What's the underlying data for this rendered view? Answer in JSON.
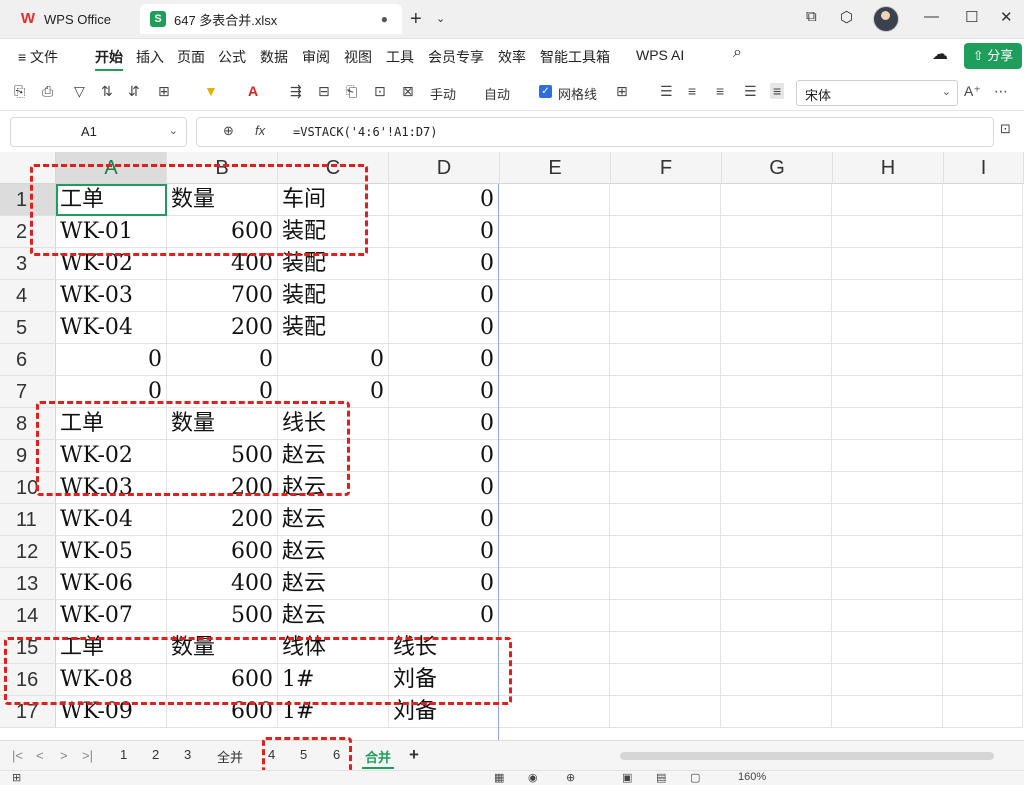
{
  "titlebar": {
    "app_tab_label": "WPS Office",
    "file_tab_label": "647 多表合并.xlsx",
    "close_glyph": "●",
    "new_tab_glyph": "+",
    "new_tab_more_glyph": "⌄",
    "controls": [
      "⧉",
      "⬡",
      "—",
      "☐",
      "✕"
    ]
  },
  "menu": {
    "items": [
      "≡ 文件",
      "开始",
      "插入",
      "页面",
      "公式",
      "数据",
      "审阅",
      "视图",
      "工具",
      "会员专享",
      "效率",
      "智能工具箱",
      "WPS AI"
    ],
    "active": "开始",
    "search_glyph": "⌕",
    "cloud_glyph": "☁",
    "share_label": "⇧ 分享"
  },
  "toolbar": {
    "icons": [
      "⎘",
      "⎙",
      "▽",
      "⇅",
      "⇵",
      "⊞",
      "▼",
      "A",
      "▼",
      "⇶",
      "⊟",
      "⎗",
      "⊡",
      "⊠"
    ],
    "manual_label": "手动",
    "auto_label": "自动",
    "gridlines_label": "网格线",
    "font_name": "宋体",
    "more_glyph": "⋯",
    "fontsize_glyph": "A⁺"
  },
  "formula_bar": {
    "name_box": "A1",
    "fx_label": "fx",
    "zoom_glyph": "⊕",
    "formula": "=VSTACK('4:6'!A1:D7)"
  },
  "columns": [
    "A",
    "B",
    "C",
    "D",
    "E",
    "F",
    "G",
    "H",
    "I"
  ],
  "rows": [
    {
      "n": "1",
      "a": "工单",
      "b": "数量",
      "c": "车间",
      "d": "0"
    },
    {
      "n": "2",
      "a": "WK-01",
      "b": "600",
      "c": "装配",
      "d": "0"
    },
    {
      "n": "3",
      "a": "WK-02",
      "b": "400",
      "c": "装配",
      "d": "0"
    },
    {
      "n": "4",
      "a": "WK-03",
      "b": "700",
      "c": "装配",
      "d": "0"
    },
    {
      "n": "5",
      "a": "WK-04",
      "b": "200",
      "c": "装配",
      "d": "0"
    },
    {
      "n": "6",
      "a": "0",
      "b": "0",
      "c": "0",
      "d": "0"
    },
    {
      "n": "7",
      "a": "0",
      "b": "0",
      "c": "0",
      "d": "0"
    },
    {
      "n": "8",
      "a": "工单",
      "b": "数量",
      "c": "线长",
      "d": "0"
    },
    {
      "n": "9",
      "a": "WK-02",
      "b": "500",
      "c": "赵云",
      "d": "0"
    },
    {
      "n": "10",
      "a": "WK-03",
      "b": "200",
      "c": "赵云",
      "d": "0"
    },
    {
      "n": "11",
      "a": "WK-04",
      "b": "200",
      "c": "赵云",
      "d": "0"
    },
    {
      "n": "12",
      "a": "WK-05",
      "b": "600",
      "c": "赵云",
      "d": "0"
    },
    {
      "n": "13",
      "a": "WK-06",
      "b": "400",
      "c": "赵云",
      "d": "0"
    },
    {
      "n": "14",
      "a": "WK-07",
      "b": "500",
      "c": "赵云",
      "d": "0"
    },
    {
      "n": "15",
      "a": "工单",
      "b": "数量",
      "c": "线体",
      "d": "线长"
    },
    {
      "n": "16",
      "a": "WK-08",
      "b": "600",
      "c": "1#",
      "d": "刘备"
    },
    {
      "n": "17",
      "a": "WK-09",
      "b": "600",
      "c": "1#",
      "d": "刘备"
    }
  ],
  "sheet_tabs": {
    "nav": [
      "|<",
      "<",
      ">",
      ">|"
    ],
    "tabs": [
      "1",
      "2",
      "3",
      "全并",
      "4",
      "5",
      "6",
      "合并"
    ],
    "active": "合并",
    "add_glyph": "+"
  },
  "status": {
    "left": "⊞",
    "zoom": "160%",
    "view_icons": [
      "▦",
      "◉",
      "⊕",
      "▣",
      "▤",
      "▢"
    ]
  },
  "colors": {
    "accent": "#1e9e5a",
    "highlight": "#e0201b"
  }
}
